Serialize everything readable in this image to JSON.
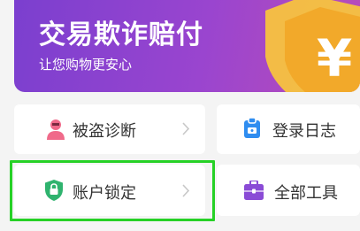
{
  "banner": {
    "title": "交易欺诈赔付",
    "subtitle": "让您购物更安心",
    "currency_symbol": "¥"
  },
  "menu": {
    "theft_diagnosis": "被盗诊断",
    "login_log": "登录日志",
    "account_lock": "账户锁定",
    "all_tools": "全部工具"
  },
  "colors": {
    "banner_start": "#7b3fcf",
    "banner_end": "#b94db8",
    "shield_gold": "#f5b731",
    "highlight_green": "#26d126",
    "lock_green": "#2fb36e",
    "log_blue": "#2f8df0",
    "tool_purple": "#8a4bd6",
    "person_pink": "#f06a8a"
  }
}
